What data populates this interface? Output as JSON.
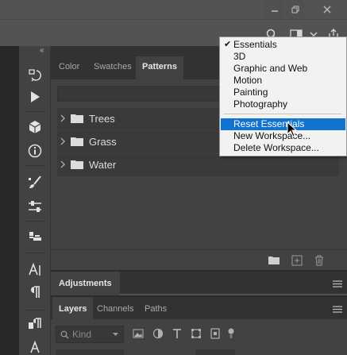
{
  "window": {
    "controls": [
      "minimize-icon",
      "restore-icon",
      "close-icon"
    ]
  },
  "options_bar": {
    "icons": [
      "search-icon",
      "workspace-icon",
      "chevron-down-icon",
      "share-icon"
    ]
  },
  "toolbar": {
    "collapse_glyph": "«",
    "tools": [
      "history-brush-icon",
      "play-icon",
      "3d-cube-icon",
      "info-icon",
      "brush-settings-icon",
      "sliders-icon",
      "stamp-icon",
      "character-icon",
      "paragraph-icon",
      "paragraph-styles-icon",
      "character-styles-icon"
    ]
  },
  "patterns_panel": {
    "tabs": [
      {
        "label": "Color",
        "active": false
      },
      {
        "label": "Swatches",
        "active": false
      },
      {
        "label": "Patterns",
        "active": true
      }
    ],
    "groups": [
      {
        "label": "Trees"
      },
      {
        "label": "Grass"
      },
      {
        "label": "Water"
      }
    ],
    "footer_icons": [
      "new-group-icon",
      "new-pattern-icon",
      "delete-icon"
    ]
  },
  "adjustments_panel": {
    "tab_label": "Adjustments"
  },
  "layers_panel": {
    "tabs": [
      {
        "label": "Layers",
        "active": true
      },
      {
        "label": "Channels",
        "active": false
      },
      {
        "label": "Paths",
        "active": false
      }
    ],
    "filter_placeholder": "Kind",
    "filter_icons": [
      "image-filter-icon",
      "adjustment-filter-icon",
      "type-filter-icon",
      "shape-filter-icon",
      "smart-object-filter-icon",
      "filter-toggle-icon"
    ]
  },
  "workspace_menu": {
    "items": [
      {
        "label": "Essentials",
        "checked": true
      },
      {
        "label": "3D",
        "checked": false
      },
      {
        "label": "Graphic and Web",
        "checked": false
      },
      {
        "label": "Motion",
        "checked": false
      },
      {
        "label": "Painting",
        "checked": false
      },
      {
        "label": "Photography",
        "checked": false
      }
    ],
    "actions": [
      {
        "label": "Reset Essentials",
        "highlighted": true
      },
      {
        "label": "New Workspace...",
        "highlighted": false
      },
      {
        "label": "Delete Workspace...",
        "highlighted": false
      }
    ]
  },
  "colors": {
    "highlight": "#0f73cf",
    "panel": "#424242",
    "tabstrip": "#323232",
    "menu_bg": "#f2f2f2"
  }
}
